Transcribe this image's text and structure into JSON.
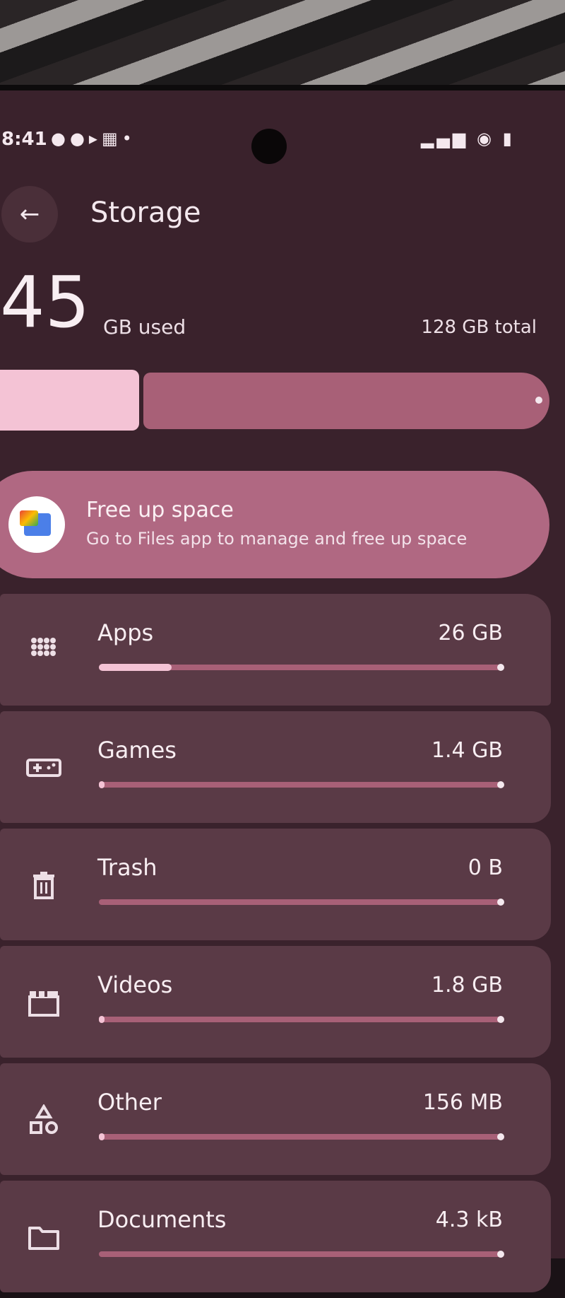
{
  "status_bar": {
    "time": "8:41",
    "left_icons": [
      "snapchat-icon",
      "snapchat-icon",
      "bing-icon",
      "gallery-icon",
      "dot-icon"
    ],
    "right_icons": [
      "signal-icon",
      "wifi-icon",
      "battery-icon"
    ]
  },
  "header": {
    "back_icon": "arrow-left-icon",
    "title": "Storage"
  },
  "summary": {
    "used_value": "45",
    "used_unit": "GB used",
    "total": "128 GB total",
    "used_fraction": 0.3516
  },
  "free_up": {
    "icon": "files-app-icon",
    "title": "Free up space",
    "subtitle": "Go to Files app to manage and free up space"
  },
  "categories": [
    {
      "icon": "apps-grid-icon",
      "label": "Apps",
      "size": "26 GB",
      "fraction": 0.2
    },
    {
      "icon": "gamepad-icon",
      "label": "Games",
      "size": "1.4 GB",
      "fraction": 0.011
    },
    {
      "icon": "trash-icon",
      "label": "Trash",
      "size": "0 B",
      "fraction": 0
    },
    {
      "icon": "video-clapper-icon",
      "label": "Videos",
      "size": "1.8 GB",
      "fraction": 0.014
    },
    {
      "icon": "shapes-icon",
      "label": "Other",
      "size": "156 MB",
      "fraction": 0.001
    },
    {
      "icon": "folder-icon",
      "label": "Documents",
      "size": "4.3 kB",
      "fraction": 0
    }
  ],
  "colors": {
    "background": "#3a222c",
    "accent": "#f4c3d5",
    "track": "#a86077",
    "row": "#5a3a46"
  }
}
